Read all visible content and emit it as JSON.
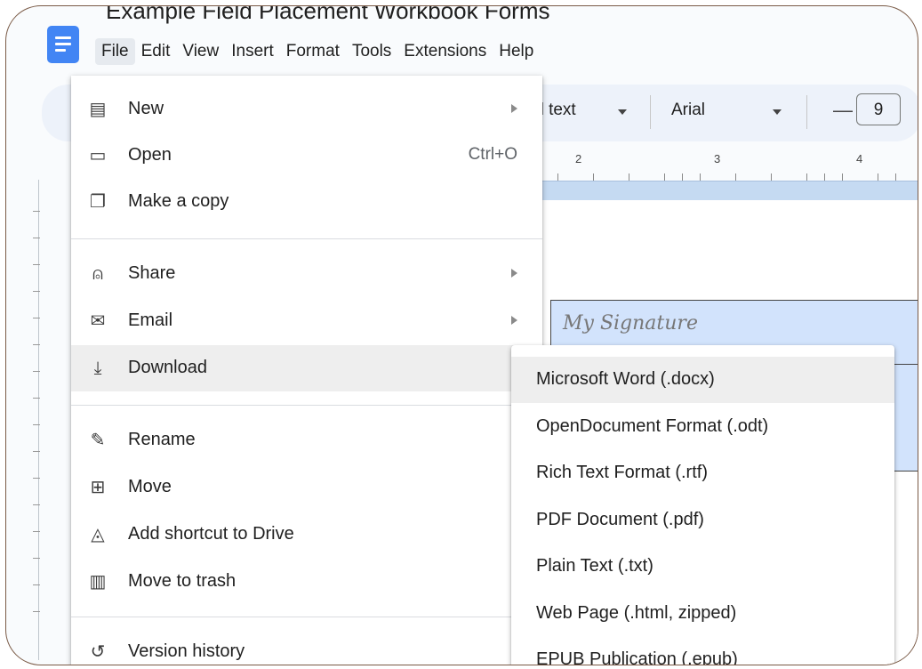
{
  "header": {
    "doc_title": "Example Field Placement Workbook Forms",
    "menus": [
      "File",
      "Edit",
      "View",
      "Insert",
      "Format",
      "Tools",
      "Extensions",
      "Help"
    ]
  },
  "toolbar": {
    "style_value": "al text",
    "font_value": "Arial",
    "minus_label": "—",
    "font_size": "9"
  },
  "ruler": {
    "labels": [
      "2",
      "3",
      "4"
    ]
  },
  "page": {
    "signature_text": "My Signature"
  },
  "file_menu": {
    "items": [
      {
        "label": "New",
        "icon": "doc-icon",
        "submenu": true
      },
      {
        "label": "Open",
        "icon": "folder-icon",
        "shortcut": "Ctrl+O"
      },
      {
        "label": "Make a copy",
        "icon": "copy-icon"
      },
      {
        "label": "Share",
        "icon": "person-add-icon",
        "submenu": true
      },
      {
        "label": "Email",
        "icon": "mail-icon",
        "submenu": true
      },
      {
        "label": "Download",
        "icon": "download-icon",
        "submenu": true,
        "highlighted": true
      },
      {
        "label": "Rename",
        "icon": "rename-icon"
      },
      {
        "label": "Move",
        "icon": "move-folder-icon"
      },
      {
        "label": "Add shortcut to Drive",
        "icon": "drive-shortcut-icon"
      },
      {
        "label": "Move to trash",
        "icon": "trash-icon"
      },
      {
        "label": "Version history",
        "icon": "history-icon",
        "submenu": true
      }
    ]
  },
  "download_menu": {
    "items": [
      {
        "label": "Microsoft Word (.docx)",
        "highlighted": true
      },
      {
        "label": "OpenDocument Format (.odt)"
      },
      {
        "label": "Rich Text Format (.rtf)"
      },
      {
        "label": "PDF Document (.pdf)"
      },
      {
        "label": "Plain Text (.txt)"
      },
      {
        "label": "Web Page (.html, zipped)"
      },
      {
        "label": "EPUB Publication (.epub)"
      }
    ]
  }
}
